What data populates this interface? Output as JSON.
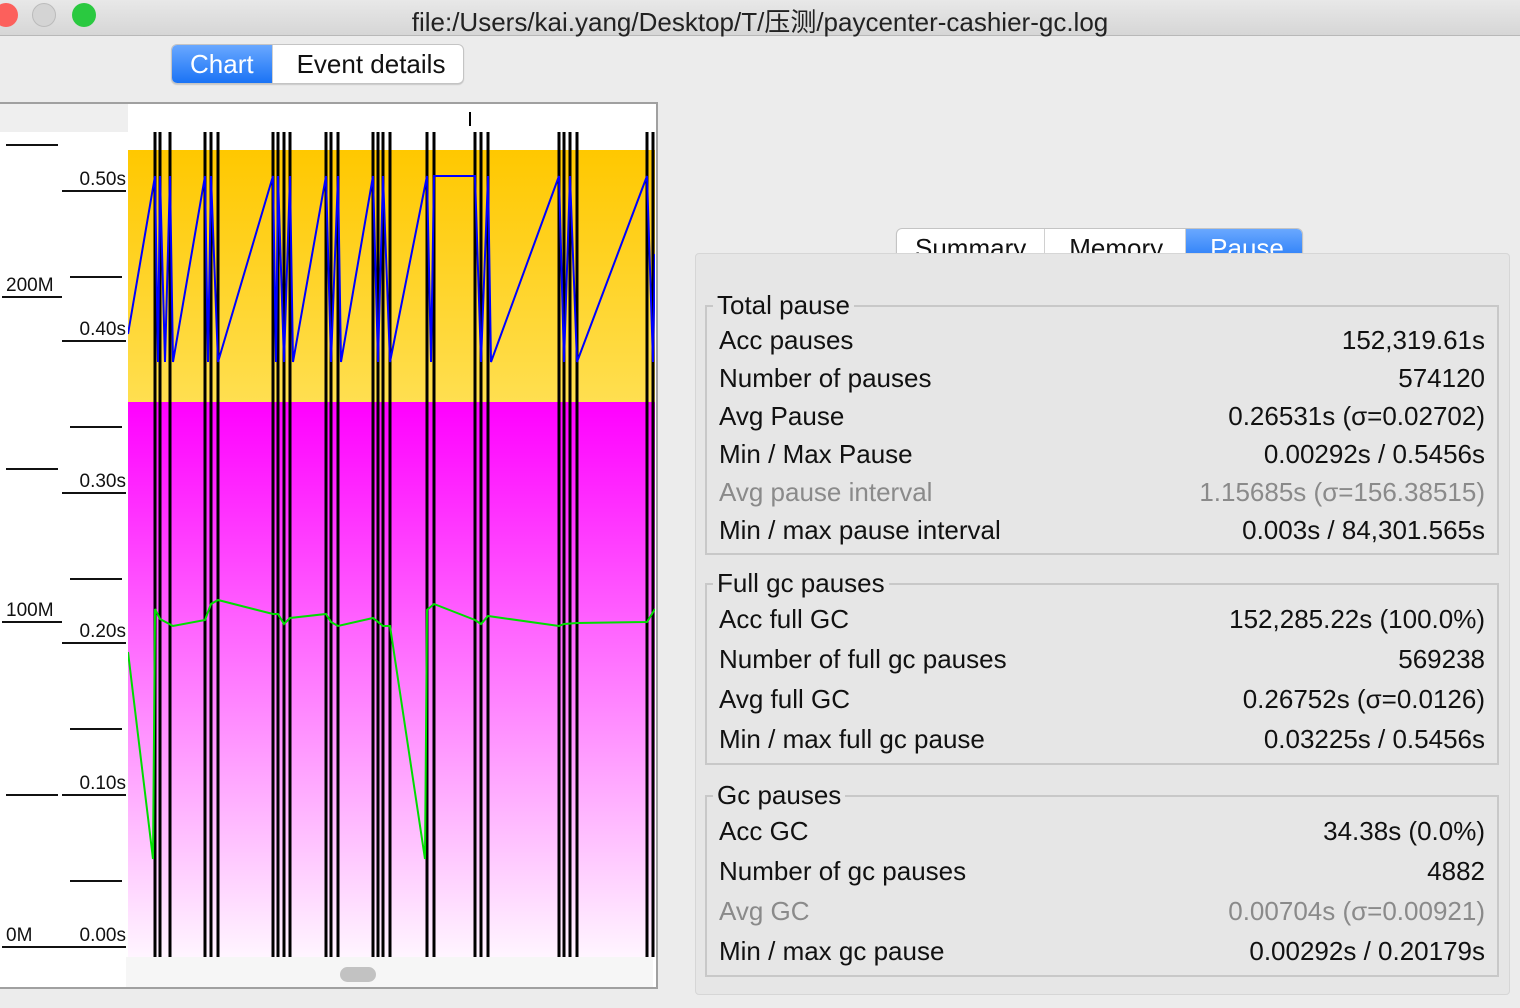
{
  "window": {
    "title": "file:/Users/kai.yang/Desktop/T/压测/paycenter-cashier-gc.log"
  },
  "left_tabs": [
    {
      "label": "Chart",
      "selected": true
    },
    {
      "label": "Event details",
      "selected": false
    }
  ],
  "chart": {
    "pause_ticks": [
      "0.50s",
      "0.40s",
      "0.30s",
      "0.20s",
      "0.10s",
      "0.00s"
    ],
    "memory_ticks": [
      "200M",
      "100M",
      "0M"
    ],
    "colors": {
      "total_heap": "#ffc800",
      "used_heap": "#ff00ff",
      "gc_lines": "#000000",
      "full_gc": "#0000ff",
      "used_after": "#00dd00"
    }
  },
  "right_tabs": [
    {
      "label": "Summary",
      "selected": false
    },
    {
      "label": "Memory",
      "selected": false
    },
    {
      "label": "Pause",
      "selected": true
    }
  ],
  "groups": [
    {
      "title": "Total pause",
      "rows": [
        {
          "label": "Acc pauses",
          "value": "152,319.61s"
        },
        {
          "label": "Number of pauses",
          "value": "574120"
        },
        {
          "label": "Avg Pause",
          "value": "0.26531s (σ=0.02702)"
        },
        {
          "label": "Min / Max Pause",
          "value": "0.00292s / 0.5456s"
        },
        {
          "label": "Avg pause interval",
          "value": "1.15685s (σ=156.38515)",
          "dim": true
        },
        {
          "label": "Min / max pause interval",
          "value": "0.003s / 84,301.565s"
        }
      ]
    },
    {
      "title": "Full gc pauses",
      "rows": [
        {
          "label": "Acc full GC",
          "value": "152,285.22s (100.0%)"
        },
        {
          "label": "Number of full gc pauses",
          "value": "569238"
        },
        {
          "label": "Avg full GC",
          "value": "0.26752s (σ=0.0126)"
        },
        {
          "label": "Min / max full gc pause",
          "value": "0.03225s / 0.5456s"
        }
      ]
    },
    {
      "title": "Gc pauses",
      "rows": [
        {
          "label": "Acc GC",
          "value": "34.38s (0.0%)"
        },
        {
          "label": "Number of gc pauses",
          "value": "4882"
        },
        {
          "label": "Avg GC",
          "value": "0.00704s (σ=0.00921)",
          "dim": true
        },
        {
          "label": "Min / max gc pause",
          "value": "0.00292s / 0.20179s"
        }
      ]
    }
  ]
}
